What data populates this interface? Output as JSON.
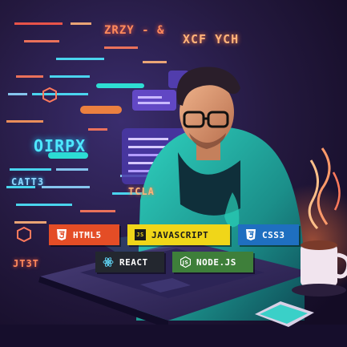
{
  "background_text": [
    {
      "text": "ZRZY - &",
      "color": "#ff8a5c"
    },
    {
      "text": "XCF YCH",
      "color": "#ffb37a"
    },
    {
      "text": "OIRPX",
      "color": "#4ee8ff"
    },
    {
      "text": "CATT3",
      "color": "#8fd7ff"
    },
    {
      "text": "TCLA",
      "color": "#ffb37a"
    },
    {
      "text": "JT3T",
      "color": "#ff8a5c"
    }
  ],
  "badges": [
    {
      "label": "HTML5",
      "icon": "html5-icon",
      "bg": "#e44d26",
      "fg": "#ffffff"
    },
    {
      "label": "JAVASCRIPT",
      "icon": "javascript-icon",
      "bg": "#f0d619",
      "fg": "#1a1a1a"
    },
    {
      "label": "CSS3",
      "icon": "css3-icon",
      "bg": "#1f6fc0",
      "fg": "#ffffff"
    },
    {
      "label": "REACT",
      "icon": "react-icon",
      "bg": "#23272f",
      "fg": "#ffffff"
    },
    {
      "label": "NODE.JS",
      "icon": "nodejs-icon",
      "bg": "#3e7f3a",
      "fg": "#ffffff"
    }
  ],
  "icon_glyphs": {
    "javascript": "JS"
  }
}
